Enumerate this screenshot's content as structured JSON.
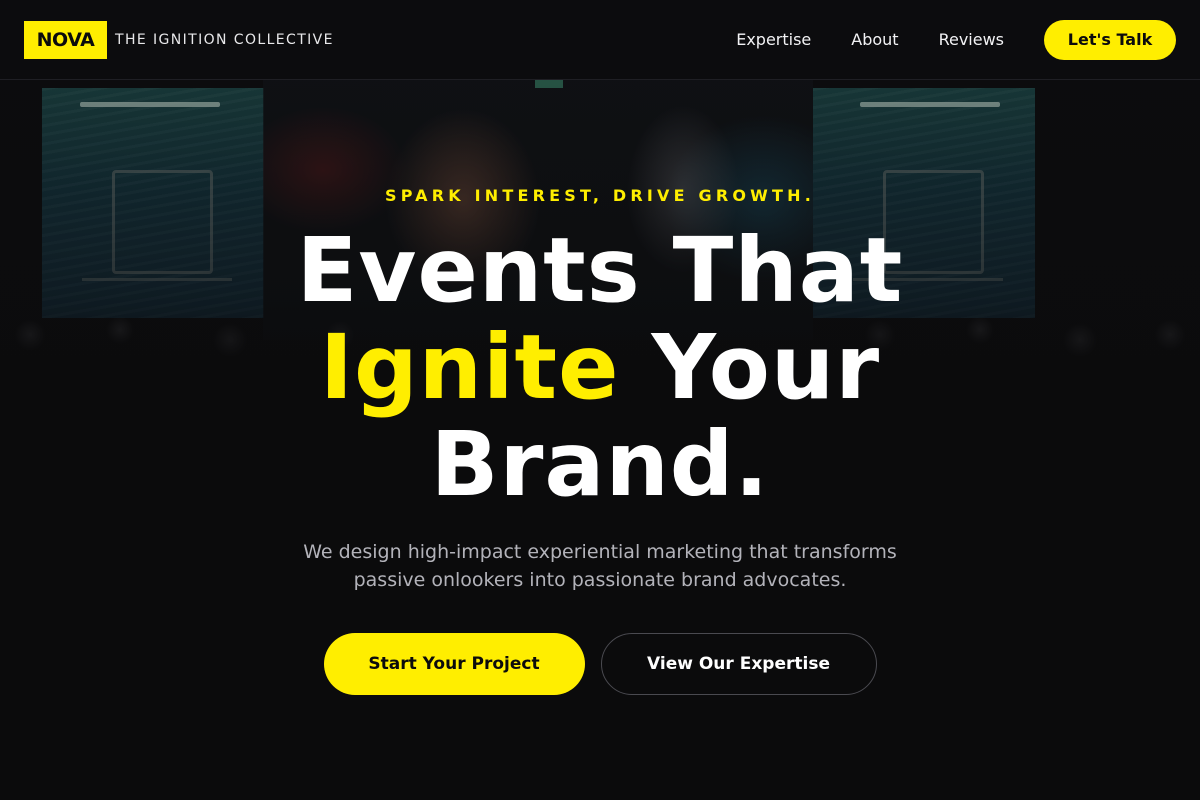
{
  "header": {
    "logo_text": "NOVA",
    "tagline": "THE IGNITION COLLECTIVE",
    "nav": [
      "Expertise",
      "About",
      "Reviews"
    ],
    "cta_label": "Let's Talk"
  },
  "hero": {
    "background_image": "event-stage-crowd-photo",
    "eyebrow": "SPARK INTEREST, DRIVE GROWTH.",
    "headline_line1": "Events That",
    "headline_accent": "Ignite",
    "headline_line2_rest": " Your",
    "headline_line3": "Brand.",
    "subtext_line1": "We design high-impact experiential marketing that transforms",
    "subtext_line2": "passive onlookers into passionate brand advocates.",
    "primary_button": "Start Your Project",
    "secondary_button": "View Our Expertise"
  },
  "colors": {
    "accent": "#ffee00",
    "background": "#0b0b0c",
    "text": "#ffffff",
    "muted_text": "#b3b3ba"
  }
}
